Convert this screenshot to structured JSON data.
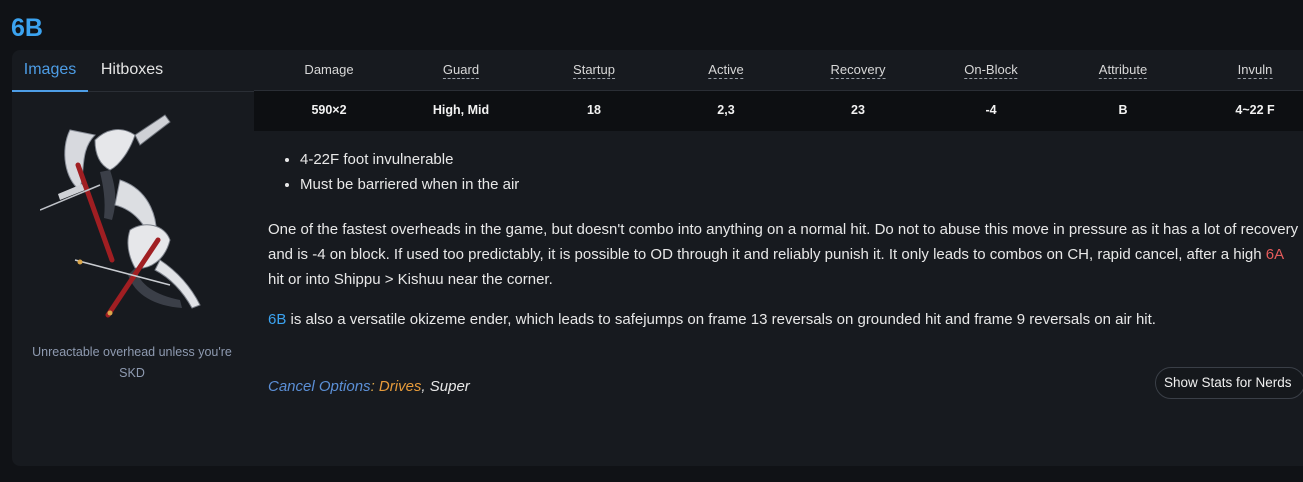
{
  "page": {
    "title": "6B"
  },
  "media": {
    "tabs": [
      {
        "label": "Images",
        "active": true
      },
      {
        "label": "Hitboxes",
        "active": false
      }
    ],
    "caption": "Unreactable overhead unless you're SKD"
  },
  "stats": {
    "headers": [
      "Damage",
      "Guard",
      "Startup",
      "Active",
      "Recovery",
      "On-Block",
      "Attribute",
      "Invuln"
    ],
    "values": [
      "590×2",
      "High, Mid",
      "18",
      "2,3",
      "23",
      "-4",
      "B",
      "4~22 F"
    ]
  },
  "notes": [
    "4-22F foot invulnerable",
    "Must be barriered when in the air"
  ],
  "description": {
    "p1_before": "One of the fastest overheads in the game, but doesn't combo into anything on a normal hit. Do not to abuse this move in pressure as it has a lot of recovery and is -4 on block. If used too predictably, it is possible to OD through it and reliably punish it. It only leads to combos on CH, rapid cancel, after a high ",
    "p1_link": "6A",
    "p1_after": " hit or into Shippu > Kishuu near the corner.",
    "p2_link": "6B",
    "p2_after": " is also a versatile okizeme ender, which leads to safejumps on frame 13 reversals on grounded hit and frame 9 reversals on air hit."
  },
  "cancel": {
    "label": "Cancel Options",
    "colon": ":",
    "drives": "Drives",
    "comma": ",",
    "super": "Super"
  },
  "nerd_button": {
    "label": "Show Stats for Nerds"
  },
  "colors": {
    "title_blue": "#3ba3f0",
    "link_red": "#e35b5b",
    "drives_orange": "#e59a3a",
    "cancel_blue": "#5b8fd6"
  }
}
